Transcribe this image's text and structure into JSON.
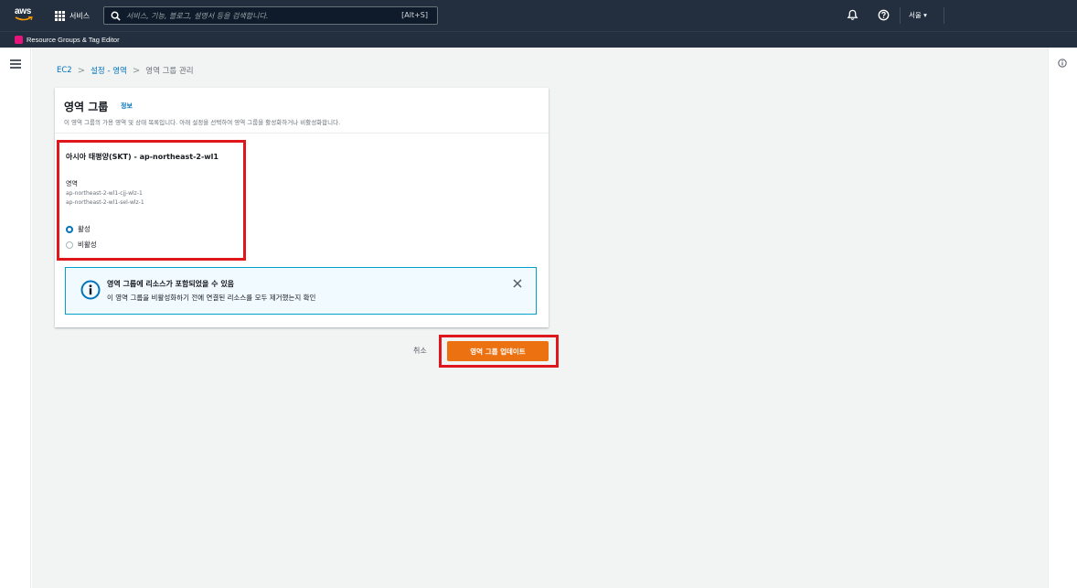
{
  "topnav": {
    "logo_text": "aws",
    "services_label": "서비스",
    "search_placeholder": "서비스, 기능, 블로그, 설명서 등을 검색합니다.",
    "search_shortcut": "[Alt+S]",
    "region_label": "서울 ▾"
  },
  "subnav": {
    "resource_groups_label": "Resource Groups & Tag Editor"
  },
  "breadcrumb": {
    "items": [
      "EC2",
      "설정 - 영역",
      "영역 그룹 관리"
    ],
    "separator": ">"
  },
  "panel": {
    "title": "영역 그룹",
    "info_link": "정보",
    "description": "이 영역 그룹의 가용 영역 및 상태 목록입니다. 아래 설정을 선택하여 영역 그룹을 활성화하거나 비활성화합니다."
  },
  "zone_group": {
    "name": "아시아 태평양(SKT) - ap-northeast-2-wl1",
    "zones_label": "영역",
    "zones": [
      "ap-northeast-2-wl1-cjj-wlz-1",
      "ap-northeast-2-wl1-sel-wlz-1"
    ],
    "options": [
      {
        "label": "활성",
        "selected": true
      },
      {
        "label": "비활성",
        "selected": false
      }
    ]
  },
  "alert": {
    "title": "영역 그룹에 리소스가 포함되었을 수 있음",
    "body": "이 영역 그룹을 비활성화하기 전에 연결된 리소스를 모두 제거했는지 확인"
  },
  "actions": {
    "cancel_label": "취소",
    "update_label": "영역 그룹 업데이트"
  },
  "colors": {
    "nav_bg": "#232f3e",
    "primary_button": "#ec7211",
    "link": "#0073bb",
    "highlight": "#e0161d",
    "info_border": "#00a1c9"
  },
  "icons": [
    "grid-icon",
    "search-icon",
    "bell-icon",
    "help-icon",
    "menu-icon",
    "info-icon",
    "close-icon"
  ]
}
